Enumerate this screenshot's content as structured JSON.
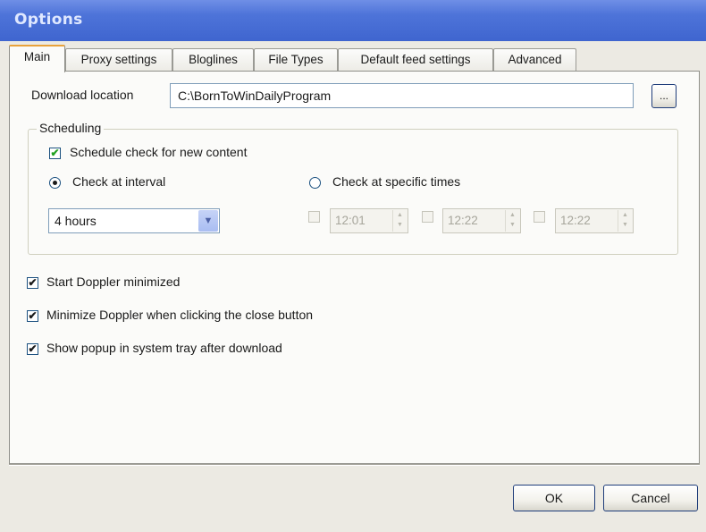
{
  "window": {
    "title": "Options"
  },
  "tabs": [
    {
      "label": "Main",
      "active": true
    },
    {
      "label": "Proxy settings",
      "active": false
    },
    {
      "label": "Bloglines",
      "active": false
    },
    {
      "label": "File Types",
      "active": false
    },
    {
      "label": "Default feed settings",
      "active": false
    },
    {
      "label": "Advanced",
      "active": false
    }
  ],
  "main": {
    "download_location_label": "Download location",
    "download_location_value": "C:\\BornToWinDailyProgram",
    "browse_label": "...",
    "scheduling": {
      "legend": "Scheduling",
      "schedule_check_label": "Schedule check for new content",
      "schedule_check_checked": true,
      "interval_radio_label": "Check at interval",
      "interval_radio_selected": true,
      "specific_radio_label": "Check at specific times",
      "specific_radio_selected": false,
      "interval_value": "4 hours",
      "times": [
        {
          "value": "12:01",
          "checked": false,
          "enabled": false
        },
        {
          "value": "12:22",
          "checked": false,
          "enabled": false
        },
        {
          "value": "12:22",
          "checked": false,
          "enabled": false
        }
      ]
    },
    "options": [
      {
        "label": "Start Doppler minimized",
        "checked": true
      },
      {
        "label": "Minimize Doppler when clicking the close button",
        "checked": true
      },
      {
        "label": "Show popup in system tray after download",
        "checked": true
      }
    ]
  },
  "buttons": {
    "ok": "OK",
    "cancel": "Cancel"
  },
  "glyphs": {
    "check": "✔",
    "combo_arrow": "▼",
    "spin_up": "▲",
    "spin_down": "▼"
  },
  "colors": {
    "titlebar": "#4e74d9",
    "tab_active_accent": "#e9a23b",
    "checkmark": "#21a121"
  }
}
